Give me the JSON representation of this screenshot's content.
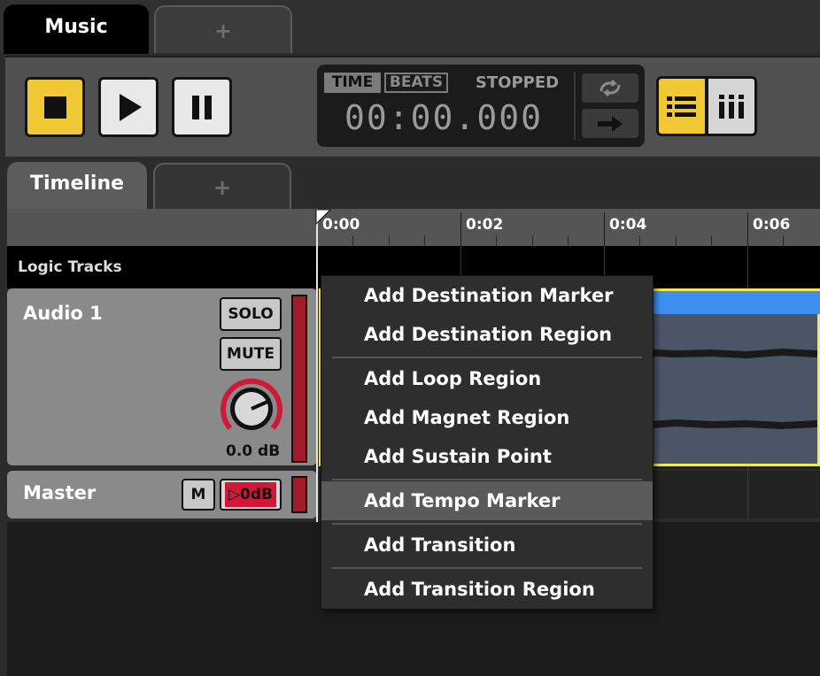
{
  "top_tabs": {
    "active": "Music",
    "add": "+"
  },
  "transport": {
    "clock": {
      "time_label": "TIME",
      "beats_label": "BEATS",
      "status": "STOPPED",
      "time": "00:00.000"
    }
  },
  "panel_tabs": {
    "active": "Timeline",
    "add": "+"
  },
  "ruler": {
    "labels": [
      "0:00",
      "0:02",
      "0:04",
      "0:06"
    ]
  },
  "logic_tracks_label": "Logic Tracks",
  "tracks": {
    "audio": {
      "name": "Audio 1",
      "solo": "SOLO",
      "mute": "MUTE",
      "volume": "0.0 dB"
    },
    "master": {
      "name": "Master",
      "m": "M",
      "gain": "0dB"
    }
  },
  "context_menu": {
    "items": [
      "Add Destination Marker",
      "Add Destination Region",
      "Add Loop Region",
      "Add Magnet Region",
      "Add Sustain Point",
      "Add Tempo Marker",
      "Add Transition",
      "Add Transition Region"
    ],
    "highlighted": "Add Tempo Marker"
  },
  "colors": {
    "accent": "#f0c935",
    "region_border": "#f4ea4a",
    "region_header": "#3f8fef",
    "meter": "#a31a2a"
  },
  "icons": [
    "stop-icon",
    "play-icon",
    "pause-icon",
    "loop-icon",
    "arrow-right-icon",
    "list-view-icon",
    "grid-view-icon",
    "knob-icon",
    "playhead-icon"
  ]
}
